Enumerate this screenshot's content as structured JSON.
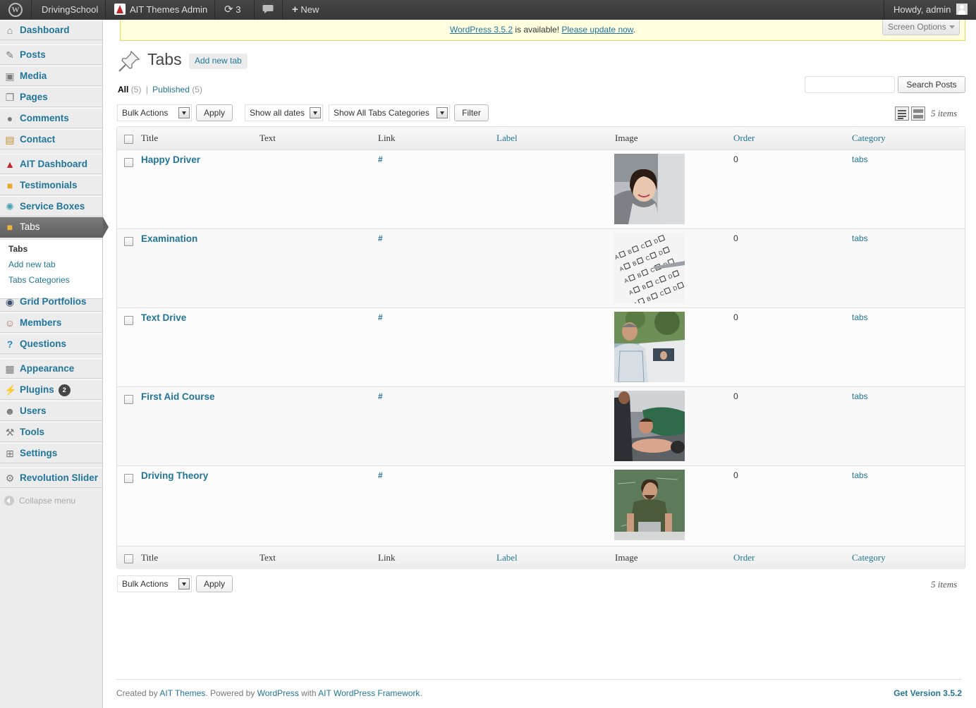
{
  "admin_bar": {
    "site_name": "DrivingSchool",
    "theme_admin": "AIT Themes Admin",
    "updates_count": "3",
    "new_label": "New",
    "howdy": "Howdy, admin"
  },
  "sidebar": {
    "items": [
      {
        "label": "Dashboard",
        "icon": "home-icon"
      },
      {
        "label": "Posts",
        "icon": "pin-icon"
      },
      {
        "label": "Media",
        "icon": "media-icon"
      },
      {
        "label": "Pages",
        "icon": "pages-icon"
      },
      {
        "label": "Comments",
        "icon": "comment-icon"
      },
      {
        "label": "Contact",
        "icon": "contact-icon"
      },
      {
        "label": "AIT Dashboard",
        "icon": "ait-icon"
      },
      {
        "label": "Testimonials",
        "icon": "box-icon"
      },
      {
        "label": "Service Boxes",
        "icon": "gear-icon"
      },
      {
        "label": "Tabs",
        "icon": "box-icon"
      },
      {
        "label": "Grid Portfolios",
        "icon": "portfolio-icon"
      },
      {
        "label": "Members",
        "icon": "member-icon"
      },
      {
        "label": "Questions",
        "icon": "question-icon"
      },
      {
        "label": "Appearance",
        "icon": "appearance-icon"
      },
      {
        "label": "Plugins",
        "icon": "plugin-icon",
        "badge": "2"
      },
      {
        "label": "Users",
        "icon": "users-icon"
      },
      {
        "label": "Tools",
        "icon": "tools-icon"
      },
      {
        "label": "Settings",
        "icon": "settings-icon"
      },
      {
        "label": "Revolution Slider",
        "icon": "gear-icon"
      }
    ],
    "submenu": [
      "Tabs",
      "Add new tab",
      "Tabs Categories"
    ],
    "collapse": "Collapse menu"
  },
  "notice": {
    "version_link": "WordPress 3.5.2",
    "middle_text": " is available! ",
    "update_link": "Please update now",
    "end": "."
  },
  "screen_options": "Screen Options",
  "page": {
    "title": "Tabs",
    "add_new": "Add new tab"
  },
  "views": {
    "all": "All",
    "all_count": "(5)",
    "sep": "|",
    "published": "Published",
    "published_count": "(5)"
  },
  "search_button": "Search Posts",
  "filters": {
    "bulk_actions": "Bulk Actions",
    "apply": "Apply",
    "dates": "Show all dates",
    "categories": "Show All Tabs Categories",
    "filter": "Filter",
    "items": "5 items"
  },
  "table": {
    "columns": [
      "Title",
      "Text",
      "Link",
      "Label",
      "Image",
      "Order",
      "Category"
    ],
    "rows": [
      {
        "title": "Happy Driver",
        "link": "#",
        "order": "0",
        "category": "tabs"
      },
      {
        "title": "Examination",
        "link": "#",
        "order": "0",
        "category": "tabs"
      },
      {
        "title": "Text Drive",
        "link": "#",
        "order": "0",
        "category": "tabs"
      },
      {
        "title": "First Aid Course",
        "link": "#",
        "order": "0",
        "category": "tabs"
      },
      {
        "title": "Driving Theory",
        "link": "#",
        "order": "0",
        "category": "tabs"
      }
    ]
  },
  "footer": {
    "created_by": "Created by ",
    "ait_link": "AIT Themes",
    "powered": ". Powered by ",
    "wp_link": "WordPress",
    "with": " with ",
    "framework_link": "AIT WordPress Framework",
    "end": ".",
    "version": "Get Version 3.5.2"
  }
}
